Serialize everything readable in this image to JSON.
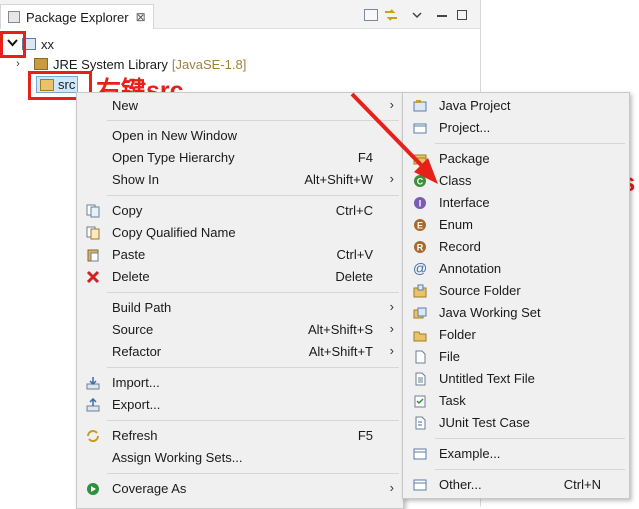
{
  "explorer": {
    "tab_label": "Package Explorer",
    "tab_close": "⊠",
    "tree": {
      "project": "xx",
      "jre_name": "JRE System Library",
      "jre_version": "[JavaSE-1.8]",
      "src": "src"
    }
  },
  "annotations": {
    "right_click_src": "右键src",
    "new_class": "即新建Class"
  },
  "context_menu": {
    "new": "New",
    "open_new_window": "Open in New Window",
    "open_type_hierarchy": "Open Type Hierarchy",
    "open_type_hierarchy_key": "F4",
    "show_in": "Show In",
    "show_in_key": "Alt+Shift+W",
    "copy": "Copy",
    "copy_key": "Ctrl+C",
    "copy_qualified": "Copy Qualified Name",
    "paste": "Paste",
    "paste_key": "Ctrl+V",
    "delete": "Delete",
    "delete_key": "Delete",
    "build_path": "Build Path",
    "source": "Source",
    "source_key": "Alt+Shift+S",
    "refactor": "Refactor",
    "refactor_key": "Alt+Shift+T",
    "import": "Import...",
    "export": "Export...",
    "refresh": "Refresh",
    "refresh_key": "F5",
    "assign_working_sets": "Assign Working Sets...",
    "coverage_as": "Coverage As"
  },
  "new_submenu": {
    "java_project": "Java Project",
    "project": "Project...",
    "package": "Package",
    "class": "Class",
    "interface": "Interface",
    "enum": "Enum",
    "record": "Record",
    "annotation": "Annotation",
    "source_folder": "Source Folder",
    "java_working_set": "Java Working Set",
    "folder": "Folder",
    "file": "File",
    "untitled_text_file": "Untitled Text File",
    "task": "Task",
    "junit_test_case": "JUnit Test Case",
    "example": "Example...",
    "other": "Other...",
    "other_key": "Ctrl+N"
  },
  "colors": {
    "annotation_red": "#e8201a",
    "menu_bg": "#f0f0f0"
  }
}
